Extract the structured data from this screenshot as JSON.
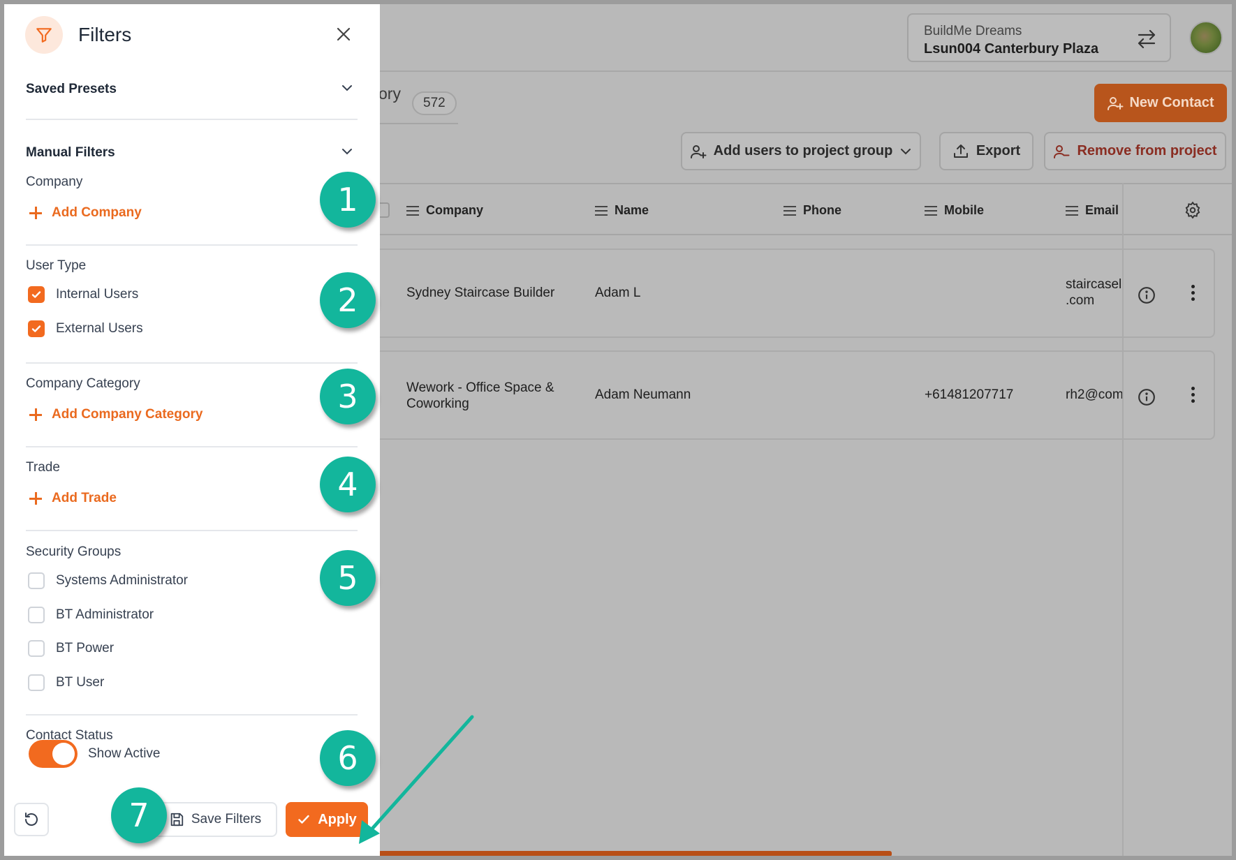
{
  "header": {
    "org_name": "BuildMe Dreams",
    "project_name": "Lsun004 Canterbury Plaza"
  },
  "tab": {
    "label_partial": "ory",
    "count": "572"
  },
  "actions": {
    "new_contact": "New Contact",
    "add_users": "Add users to project group",
    "export": "Export",
    "remove": "Remove from project"
  },
  "table": {
    "columns": [
      "Company",
      "Name",
      "Phone",
      "Mobile",
      "Email"
    ],
    "rows": [
      {
        "company": "Sydney Staircase Builder",
        "name": "Adam L",
        "phone": "",
        "mobile": "",
        "email_l1": "staircasel",
        "email_l2": ".com"
      },
      {
        "company_l1": "Wework - Office Space &",
        "company_l2": "Coworking",
        "name": "Adam Neumann",
        "phone": "",
        "mobile": "+61481207717",
        "email_l1": "rh2@com",
        "email_l2": ""
      }
    ]
  },
  "filters": {
    "title": "Filters",
    "saved_presets": "Saved Presets",
    "manual_filters": "Manual Filters",
    "company": {
      "label": "Company",
      "add": "Add Company"
    },
    "user_type": {
      "label": "User Type",
      "options": [
        {
          "label": "Internal Users",
          "checked": true
        },
        {
          "label": "External Users",
          "checked": true
        }
      ]
    },
    "company_category": {
      "label": "Company Category",
      "add": "Add Company Category"
    },
    "trade": {
      "label": "Trade",
      "add": "Add Trade"
    },
    "security_groups": {
      "label": "Security Groups",
      "options": [
        {
          "label": "Systems Administrator",
          "checked": false
        },
        {
          "label": "BT Administrator",
          "checked": false
        },
        {
          "label": "BT Power",
          "checked": false
        },
        {
          "label": "BT User",
          "checked": false
        }
      ]
    },
    "contact_status": {
      "label": "Contact Status",
      "toggle_label": "Show Active",
      "on": true
    },
    "footer": {
      "save": "Save Filters",
      "apply": "Apply"
    }
  },
  "callouts": [
    "1",
    "2",
    "3",
    "4",
    "5",
    "6",
    "7"
  ],
  "colors": {
    "accent": "#f26a1f",
    "callout": "#13b69c",
    "danger": "#8a2d22"
  }
}
